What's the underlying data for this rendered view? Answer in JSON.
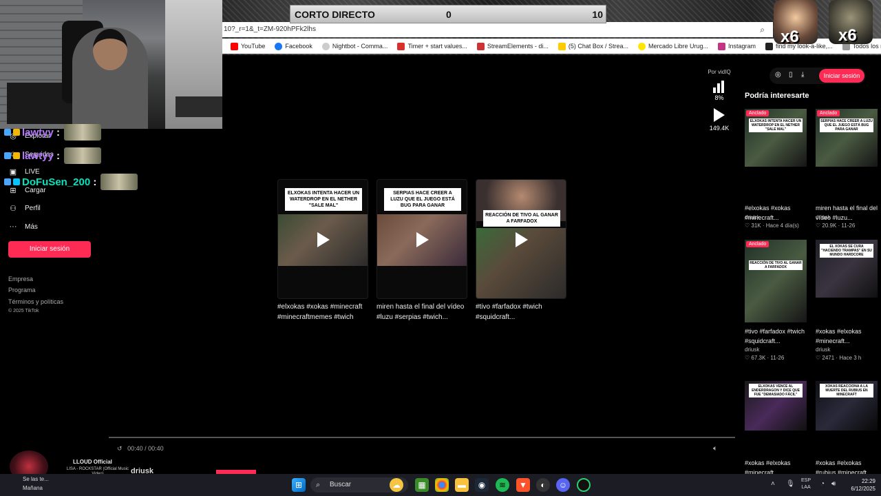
{
  "overlay": {
    "scoreboard": {
      "title": "CORTO DIRECTO",
      "left_score": "0",
      "right_score": "10"
    },
    "multipliers": [
      "x6",
      "x6"
    ]
  },
  "browser": {
    "url": "10?_r=1&_t=ZM-920hPFk2lhs",
    "bookmarks": [
      {
        "label": "YouTube",
        "color": "#ff0000"
      },
      {
        "label": "Facebook",
        "color": "#1877f2"
      },
      {
        "label": "Nightbot - Comma...",
        "color": "#cccccc"
      },
      {
        "label": "Timer + start values...",
        "color": "#d9302c"
      },
      {
        "label": "StreamElements - di...",
        "color": "#cc3333"
      },
      {
        "label": "(5) Chat Box / Strea...",
        "color": "#ffcc00"
      },
      {
        "label": "Mercado Libre Urug...",
        "color": "#ffe600"
      },
      {
        "label": "Instagram",
        "color": "#c13584"
      },
      {
        "label": "find my look-a-like,...",
        "color": "#222222"
      }
    ],
    "bookmarks_folder": "Todos los marcadores"
  },
  "chat": [
    {
      "user": "lawtyy",
      "color": "#b679ff"
    },
    {
      "user": "lawtyy",
      "color": "#b679ff"
    },
    {
      "user": "DoFuSen_200",
      "color": "#00e5c0"
    }
  ],
  "leftnav": {
    "items": [
      {
        "label": "Explorar",
        "icon": "compass-icon"
      },
      {
        "label": "Seguidos",
        "icon": "users-icon"
      },
      {
        "label": "LIVE",
        "icon": "live-icon"
      },
      {
        "label": "Cargar",
        "icon": "upload-icon"
      },
      {
        "label": "Perfil",
        "icon": "person-icon"
      },
      {
        "label": "Más",
        "icon": "more-icon"
      }
    ],
    "login_button": "Iniciar sesión",
    "footer": [
      "Empresa",
      "Programa",
      "Términos y políticas",
      "© 2025 TikTok"
    ]
  },
  "vidiq": {
    "label": "Por vidIQ",
    "percent": "8%",
    "views": "149.4K"
  },
  "videos": [
    {
      "caption": "ELXOKAS INTENTA HACER UN WATERDROP EN EL NETHER \"SALE MAL\"",
      "title": "#elxokas #xokas #minecraft #minecraftmemes #twich"
    },
    {
      "caption": "SERPIAS HACE CREER A LUZU QUE EL JUEGO ESTÁ BUG PARA GANAR",
      "title": "miren hasta el final del vídeo #luzu #serpias #twich..."
    },
    {
      "caption": "REACCIÓN DE TIVO AL GANAR A FARFADOX",
      "title": "#tivo #farfadox #twich #squidcraft..."
    }
  ],
  "right": {
    "login_button": "Iniciar sesión",
    "heading": "Podría interesarte",
    "items": [
      {
        "pinned": "Anclado",
        "caption": "ELXOKAS INTENTA HACER UN WATERDROP EN EL NETHER \"SALE MAL\"",
        "title": "#elxokas #xokas #minecraft...",
        "author": "driusk",
        "likes": "31K",
        "date": "Hace 4 día(s)"
      },
      {
        "pinned": "Anclado",
        "caption": "SERPIAS HACE CREER A LUZU QUE EL JUEGO ESTÁ BUG PARA GANAR",
        "title": "miren hasta el final del vídeo #luzu...",
        "author": "driusk",
        "likes": "20.9K",
        "date": "11-26"
      },
      {
        "pinned": "Anclado",
        "caption": "REACCIÓN DE TIVO AL GANAR A FARFADOX",
        "title": "#tivo #farfadox #twich #squidcraft...",
        "author": "driusk",
        "likes": "67.3K",
        "date": "11-26"
      },
      {
        "pinned": "",
        "caption": "EL XOKAS SE CURA \"HACIENDO TRAMPAS\" EN SU MUNDO HARDCORE",
        "title": "#xokas #elxokas #minecraft...",
        "author": "driusk",
        "likes": "2471",
        "date": "Hace 3 h"
      },
      {
        "pinned": "",
        "caption": "ELXOKAS VENCE AL ENDERDRAGON Y DICE QUE FUE \"DEMASIADO FÁCIL\"",
        "title": "#xokas #elxokas #minecraft...",
        "author": "",
        "likes": "",
        "date": ""
      },
      {
        "pinned": "",
        "caption": "XOKAS REACCIONA A LA MUERTE DEL RUBIUS EN MINECRAFT",
        "title": "#xokas #elxokas #rubius #minecraft...",
        "author": "",
        "likes": "",
        "date": ""
      }
    ]
  },
  "player": {
    "time": "00:40 / 00:40",
    "author": "driusk"
  },
  "music": {
    "artist": "LLOUD Official",
    "track": "LISA - ROCKSTAR (Official Music Video)",
    "sub": "Se las te...",
    "weather": "Mañana"
  },
  "taskbar": {
    "search": "Buscar",
    "lang": "ESP",
    "lang2": "LAA",
    "time": "22:29",
    "date": "6/12/2025"
  }
}
